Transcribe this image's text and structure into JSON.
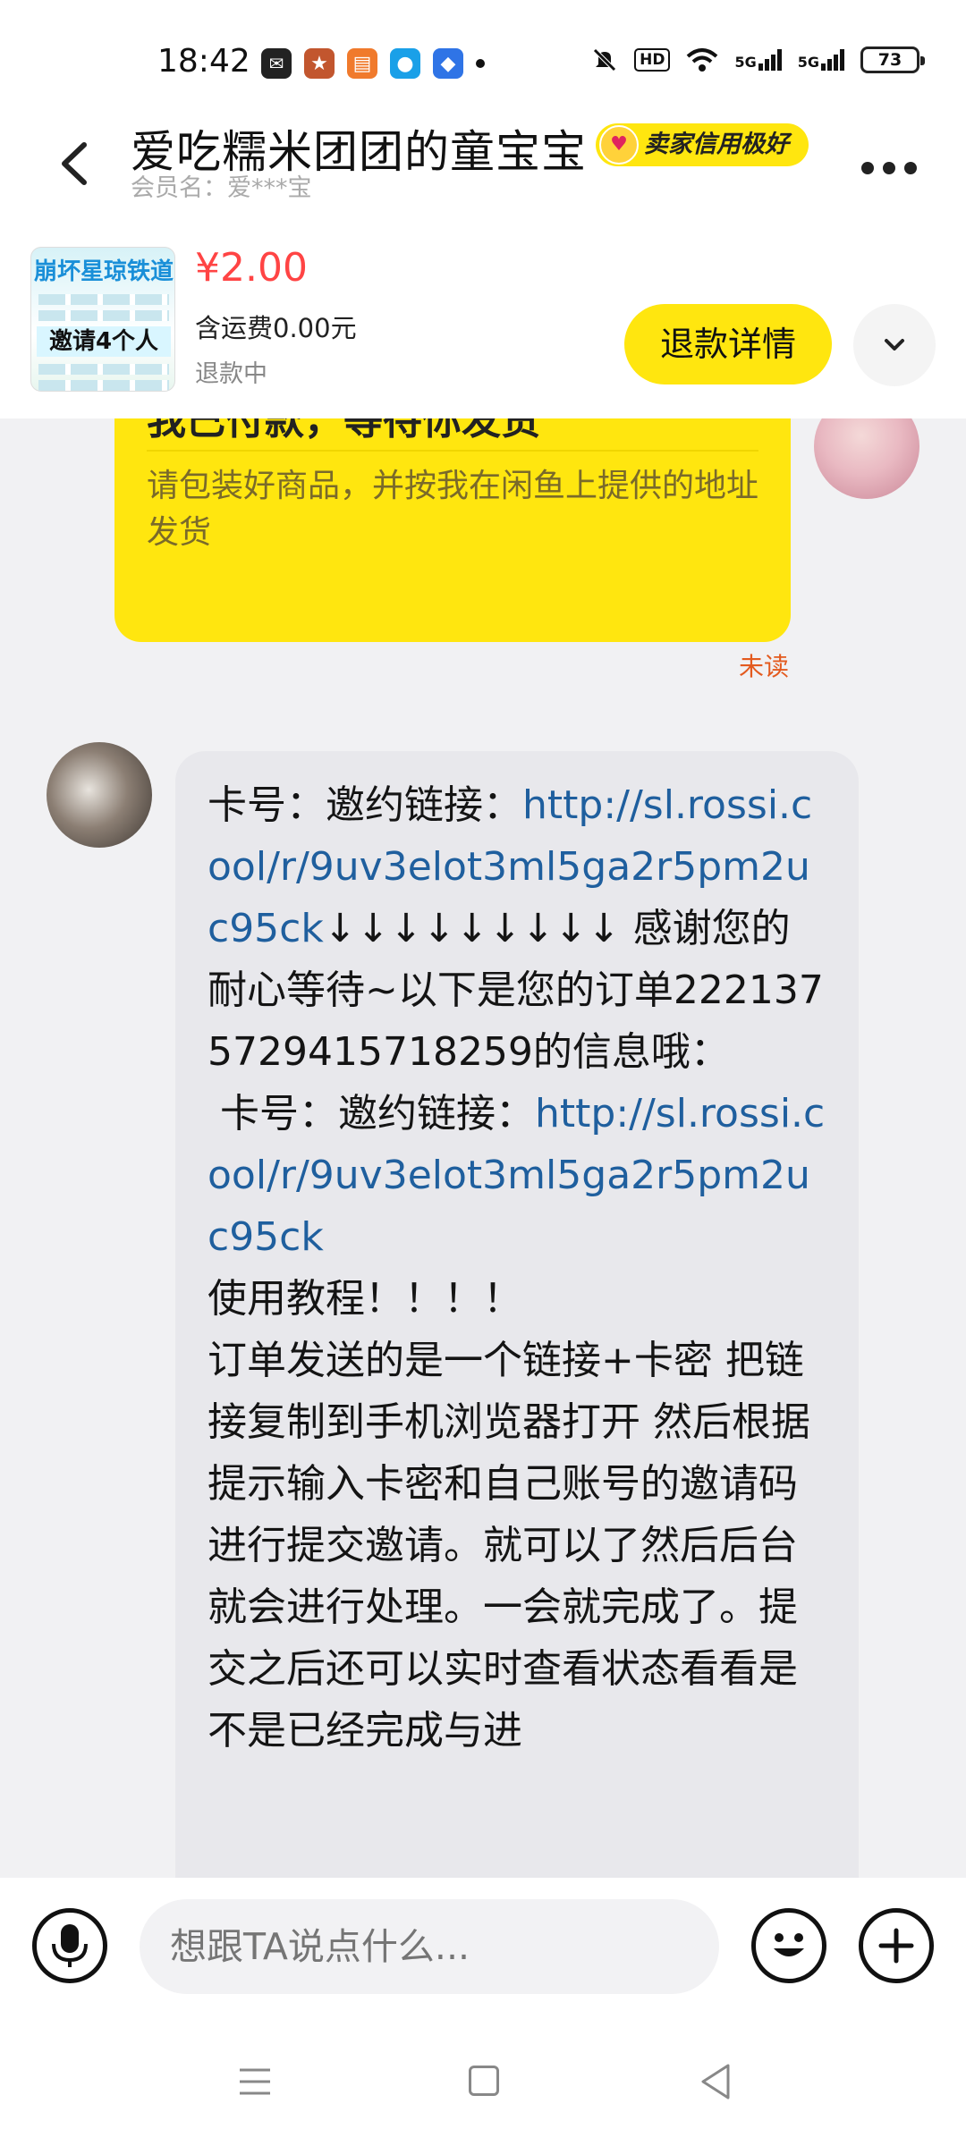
{
  "status_bar": {
    "time": "18:42",
    "network_1": "5G",
    "network_2": "5G",
    "hd_label": "HD",
    "battery": "73"
  },
  "header": {
    "title": "爱吃糯米团团的童宝宝",
    "badge": "卖家信用极好",
    "member": "会员名：爱***宝"
  },
  "product": {
    "thumb_top": "崩坏星琼铁道",
    "thumb_mid": "邀请4个人",
    "price": "¥2.00",
    "shipping": "含运费0.00元",
    "status": "退款中",
    "refund_button": "退款详情"
  },
  "chat": {
    "paid_title": "我已付款，等待你发货",
    "paid_desc": "请包装好商品，并按我在闲鱼上提供的地址发货",
    "unread": "未读",
    "seller_message": {
      "p1": "卡号：邀约链接：",
      "link1": "http://sl.rossi.cool/r/9uv3elot3ml5ga2r5pm2uc95ck",
      "p2": "↓↓↓↓↓↓↓↓↓ 感谢您的耐心等待~以下是您的订单2221375729415718259的信息哦：\n 卡号：邀约链接：",
      "link2": "http://sl.rossi.cool/r/9uv3elot3ml5ga2r5pm2uc95ck",
      "p3": "\n使用教程！！！！\n订单发送的是一个链接+卡密 把链接复制到手机浏览器打开 然后根据提示输入卡密和自己账号的邀请码进行提交邀请。就可以了然后后台就会进行处理。一会就完成了。提交之后还可以实时查看状态看看是不是已经完成与进"
    }
  },
  "input": {
    "placeholder": "想跟TA说点什么..."
  },
  "colors": {
    "accent_yellow": "#ffe60f",
    "price_red": "#ff4444",
    "link_blue": "#1f5f9e",
    "unread_orange": "#e35a1e"
  },
  "icons": [
    "back-arrow-icon",
    "more-icon",
    "chevron-down-icon",
    "microphone-icon",
    "emoji-icon",
    "plus-icon",
    "nav-menu-icon",
    "nav-home-icon",
    "nav-back-icon"
  ]
}
